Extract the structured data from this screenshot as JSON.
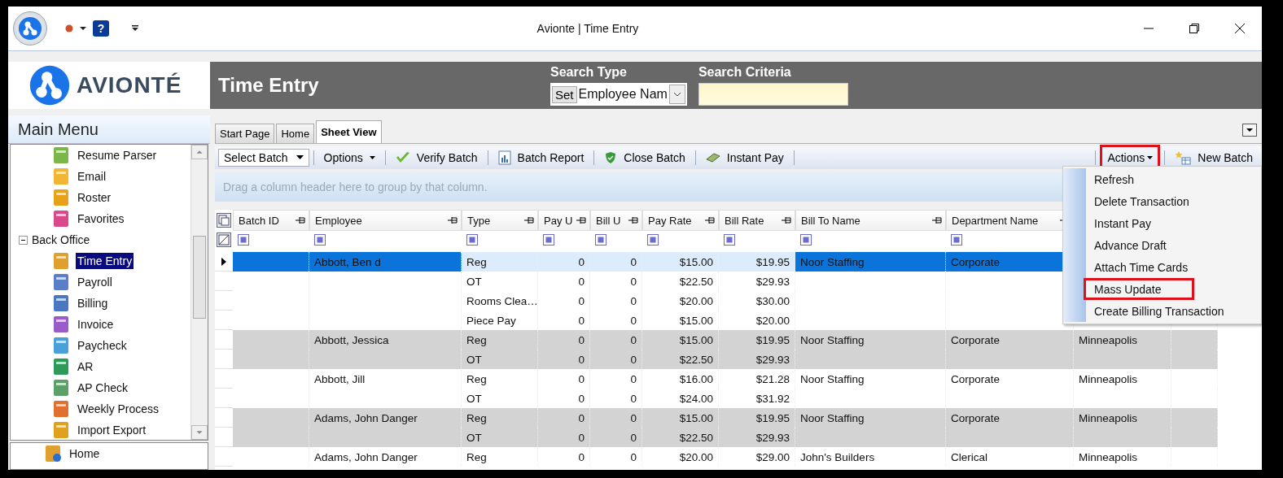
{
  "window": {
    "title": "Avionte | Time Entry"
  },
  "quick_access": {
    "help": "?"
  },
  "header": {
    "logo_text": "AVIONTÉ",
    "page_title": "Time Entry",
    "search_type": {
      "label": "Search Type",
      "button": "Set",
      "value": "Employee Nam"
    },
    "search_criteria": {
      "label": "Search Criteria"
    }
  },
  "sidebar": {
    "title": "Main Menu",
    "items": [
      {
        "label": "Resume Parser",
        "selected": false
      },
      {
        "label": "Email",
        "selected": false
      },
      {
        "label": "Roster",
        "selected": false
      },
      {
        "label": "Favorites",
        "selected": false
      },
      {
        "label": "Back Office",
        "expanded": true,
        "selected": false,
        "children": [
          {
            "label": "Time Entry",
            "selected": true
          },
          {
            "label": "Payroll",
            "selected": false
          },
          {
            "label": "Billing",
            "selected": false
          },
          {
            "label": "Invoice",
            "selected": false
          },
          {
            "label": "Paycheck",
            "selected": false
          },
          {
            "label": "AR",
            "selected": false
          },
          {
            "label": "AP Check",
            "selected": false
          },
          {
            "label": "Weekly Process",
            "selected": false
          },
          {
            "label": "Import Export",
            "selected": false
          }
        ]
      }
    ]
  },
  "bottom_panel": {
    "items": [
      {
        "label": "Home"
      }
    ]
  },
  "tabs": [
    {
      "label": "Start Page",
      "selected": false
    },
    {
      "label": "Home",
      "selected": false
    },
    {
      "label": "Sheet View",
      "selected": true
    }
  ],
  "toolbar": {
    "left": [
      {
        "label": "Select Batch",
        "kind": "dropdown"
      },
      {
        "label": "Options",
        "kind": "menu"
      },
      {
        "label": "Verify Batch",
        "kind": "button"
      },
      {
        "label": "Batch Report",
        "kind": "button"
      },
      {
        "label": "Close Batch",
        "kind": "button"
      },
      {
        "label": "Instant Pay",
        "kind": "button"
      }
    ],
    "right": [
      {
        "label": "Actions",
        "kind": "menu",
        "highlighted": true
      },
      {
        "label": "New Batch",
        "kind": "button",
        "highlighted": false
      }
    ]
  },
  "group_panel": {
    "hint": "Drag a column header here to group by that column."
  },
  "table": {
    "columns": [
      "Batch ID",
      "Employee",
      "Type",
      "Pay U",
      "Bill U",
      "Pay Rate",
      "Bill Rate",
      "Bill To Name",
      "Department Name"
    ],
    "rows": [
      {
        "employee": "Abbott, Ben d",
        "type": "Reg",
        "pay_units": "0",
        "bill_units": "0",
        "pay_rate": "$15.00",
        "bill_rate": "$19.95",
        "bill_to_name": "Noor Staffing",
        "department_name": "Corporate",
        "selected": true,
        "shaded": false
      },
      {
        "type": "OT",
        "pay_units": "0",
        "bill_units": "0",
        "pay_rate": "$22.50",
        "bill_rate": "$29.93",
        "selected": false,
        "shaded": false
      },
      {
        "type": "Rooms Clea…",
        "pay_units": "0",
        "bill_units": "0",
        "pay_rate": "$20.00",
        "bill_rate": "$30.00",
        "selected": false,
        "shaded": false
      },
      {
        "type": "Piece Pay",
        "pay_units": "0",
        "bill_units": "0",
        "pay_rate": "$15.00",
        "bill_rate": "$20.00",
        "selected": false,
        "shaded": false
      },
      {
        "employee": "Abbott, Jessica",
        "type": "Reg",
        "pay_units": "0",
        "bill_units": "0",
        "pay_rate": "$15.00",
        "bill_rate": "$19.95",
        "bill_to_name": "Noor Staffing",
        "department_name": "Corporate",
        "column_10": "Minneapolis",
        "selected": false,
        "shaded": true
      },
      {
        "type": "OT",
        "pay_units": "0",
        "bill_units": "0",
        "pay_rate": "$22.50",
        "bill_rate": "$29.93",
        "selected": false,
        "shaded": true
      },
      {
        "employee": "Abbott, Jill",
        "type": "Reg",
        "pay_units": "0",
        "bill_units": "0",
        "pay_rate": "$16.00",
        "bill_rate": "$21.28",
        "bill_to_name": "Noor Staffing",
        "department_name": "Corporate",
        "column_10": "Minneapolis",
        "selected": false,
        "shaded": false
      },
      {
        "type": "OT",
        "pay_units": "0",
        "bill_units": "0",
        "pay_rate": "$24.00",
        "bill_rate": "$31.92",
        "selected": false,
        "shaded": false
      },
      {
        "employee": "Adams, John Danger",
        "type": "Reg",
        "pay_units": "0",
        "bill_units": "0",
        "pay_rate": "$15.00",
        "bill_rate": "$19.95",
        "bill_to_name": "Noor Staffing",
        "department_name": "Corporate",
        "column_10": "Minneapolis",
        "selected": false,
        "shaded": true
      },
      {
        "type": "OT",
        "pay_units": "0",
        "bill_units": "0",
        "pay_rate": "$22.50",
        "bill_rate": "$29.93",
        "selected": false,
        "shaded": true
      },
      {
        "employee": "Adams, John Danger",
        "type": "Reg",
        "pay_units": "0",
        "bill_units": "0",
        "pay_rate": "$20.00",
        "bill_rate": "$29.00",
        "bill_to_name": "John's Builders",
        "department_name": "Clerical",
        "column_10": "Minneapolis",
        "selected": false,
        "shaded": false
      }
    ]
  },
  "actions_menu": {
    "items": [
      {
        "label": "Refresh",
        "highlighted": false
      },
      {
        "label": "Delete Transaction",
        "highlighted": false
      },
      {
        "label": "Instant Pay",
        "highlighted": false
      },
      {
        "label": "Advance Draft",
        "highlighted": false
      },
      {
        "label": "Attach Time Cards",
        "highlighted": false
      },
      {
        "label": "Mass Update",
        "highlighted": true
      },
      {
        "label": "Create Billing Transaction",
        "highlighted": false
      }
    ]
  }
}
